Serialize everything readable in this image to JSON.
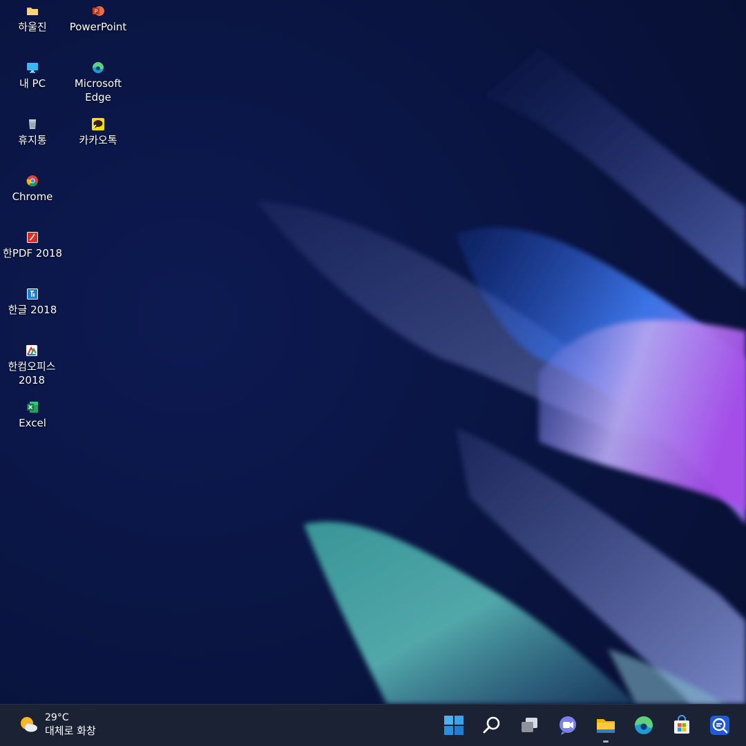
{
  "desktop": {
    "icons": [
      {
        "label": "하울진",
        "icon": "folder-icon"
      },
      {
        "label": "PowerPoint",
        "icon": "powerpoint-icon"
      },
      {
        "label": "내 PC",
        "icon": "this-pc-icon"
      },
      {
        "label": "Microsoft\nEdge",
        "icon": "edge-icon"
      },
      {
        "label": "휴지통",
        "icon": "recycle-bin-icon"
      },
      {
        "label": "카카오톡",
        "icon": "kakaotalk-icon"
      },
      {
        "label": "Chrome",
        "icon": "chrome-icon"
      },
      {
        "label": "한PDF 2018",
        "icon": "hanpdf-icon"
      },
      {
        "label": "한글 2018",
        "icon": "hangul-icon"
      },
      {
        "label": "한컴오피스\n2018",
        "icon": "hancom-office-icon"
      },
      {
        "label": "Excel",
        "icon": "excel-icon"
      }
    ]
  },
  "taskbar": {
    "weather": {
      "temp": "29°C",
      "condition": "대체로 화창",
      "icon": "partly-sunny-icon"
    },
    "buttons": [
      "start-icon",
      "search-icon",
      "task-view-icon",
      "chat-icon",
      "file-explorer-icon",
      "edge-icon",
      "store-icon",
      "app-icon"
    ]
  },
  "colors": {
    "taskbar": "#1b2233",
    "wallpaper_base": "#0b1540"
  }
}
